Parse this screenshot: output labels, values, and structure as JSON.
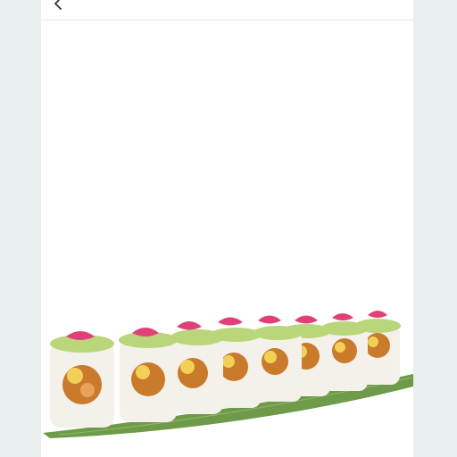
{
  "topbar": {
    "back_icon": "chevron-left-icon"
  },
  "hero": {
    "image_subject": "sushi-roll-pieces-on-bamboo-leaf",
    "colors": {
      "leaf": "#6f9a4a",
      "rice": "#f4f1ea",
      "avocado": "#b9d77a",
      "topping": "#e0407a",
      "filling": "#c97a2a",
      "egg": "#f2cf55",
      "nori": "#2b2b2b"
    }
  }
}
